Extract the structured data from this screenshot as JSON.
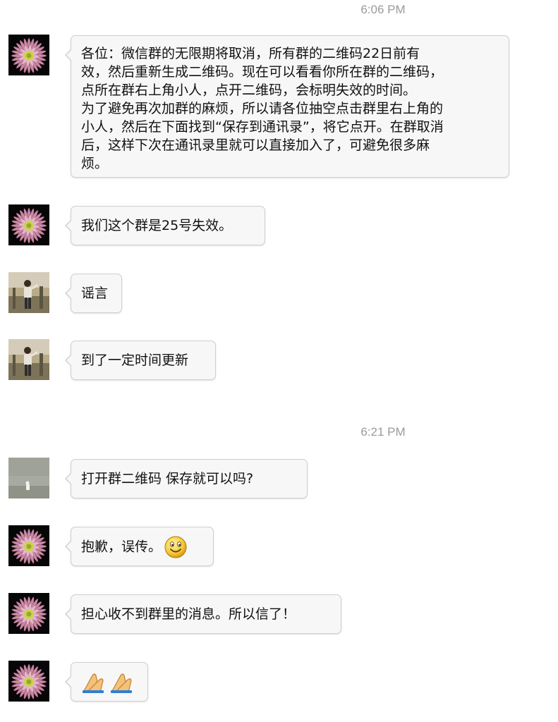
{
  "timestamps": [
    "6:06 PM",
    "6:21 PM"
  ],
  "messages": [
    {
      "sender": "flower-avatar",
      "lines": [
        "各位：微信群的无限期将取消，所有群的二维码22日前有",
        "效，然后重新生成二维码。现在可以看看你所在群的二维码，",
        "点所在群右上角小人，点开二维码，会标明失效的时间。",
        "为了避免再次加群的麻烦，所以请各位抽空点击群里右上角的",
        "小人，然后在下面找到“保存到通讯录”，将它点开。在群取消",
        "后，这样下次在通讯录里就可以直接加入了，可避免很多麻",
        "烦。"
      ]
    },
    {
      "sender": "flower-avatar",
      "text": "我们这个群是25号失效。"
    },
    {
      "sender": "person-photo-avatar",
      "text": "谣言"
    },
    {
      "sender": "person-photo-avatar",
      "text": "到了一定时间更新"
    },
    {
      "sender": "scenery-avatar",
      "text": "打开群二维码   保存就可以吗?"
    },
    {
      "sender": "flower-avatar",
      "text": "抱歉，误传。",
      "emoji": "smiley-face-icon"
    },
    {
      "sender": "flower-avatar",
      "text": "担心收不到群里的消息。所以信了！"
    },
    {
      "sender": "flower-avatar",
      "text": "",
      "emoji": "pray-hands-icon"
    }
  ]
}
